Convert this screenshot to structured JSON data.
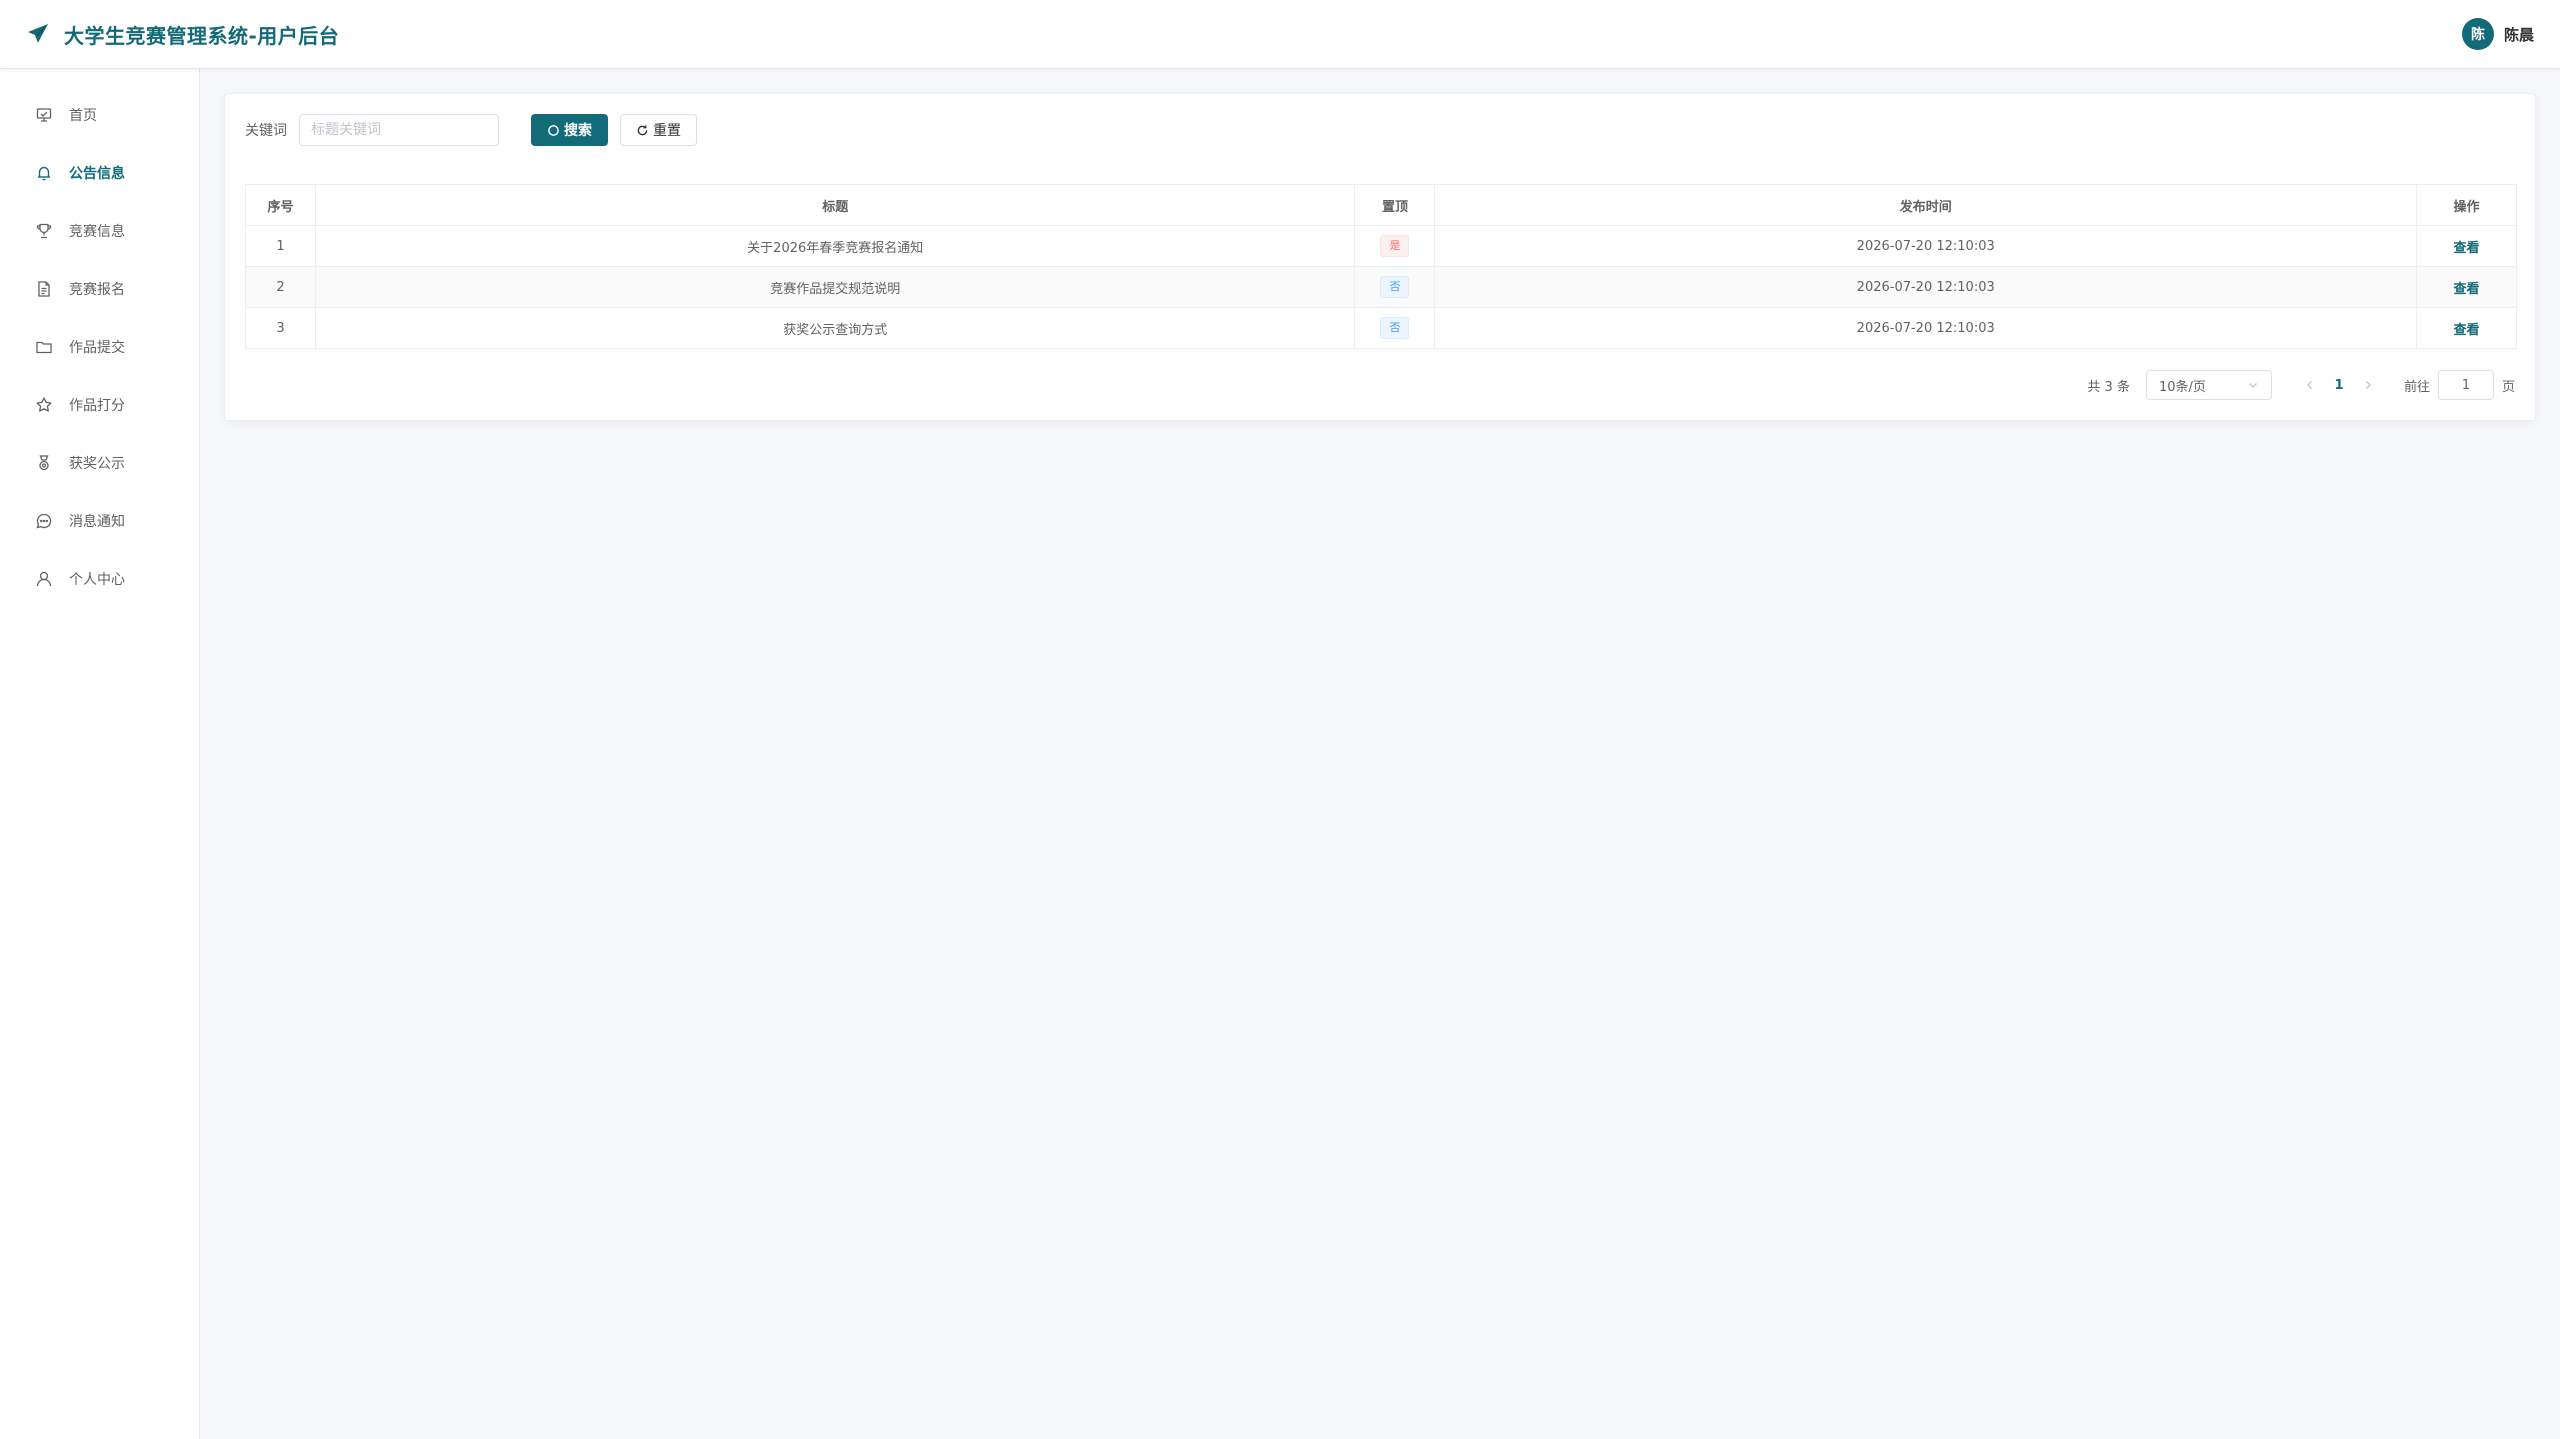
{
  "app": {
    "title": "大学生竞赛管理系统-用户后台"
  },
  "user": {
    "avatar_initial": "陈",
    "name": "陈晨"
  },
  "sidebar": {
    "items": [
      {
        "label": "首页",
        "icon": "home-icon",
        "active": false
      },
      {
        "label": "公告信息",
        "icon": "bell-icon",
        "active": true
      },
      {
        "label": "竞赛信息",
        "icon": "trophy-icon",
        "active": false
      },
      {
        "label": "竞赛报名",
        "icon": "document-icon",
        "active": false
      },
      {
        "label": "作品提交",
        "icon": "folder-icon",
        "active": false
      },
      {
        "label": "作品打分",
        "icon": "star-icon",
        "active": false
      },
      {
        "label": "获奖公示",
        "icon": "medal-icon",
        "active": false
      },
      {
        "label": "消息通知",
        "icon": "chat-icon",
        "active": false
      },
      {
        "label": "个人中心",
        "icon": "user-icon",
        "active": false
      }
    ]
  },
  "search": {
    "label": "关键词",
    "placeholder": "标题关键词",
    "value": "",
    "search_button": "搜索",
    "reset_button": "重置"
  },
  "table": {
    "headers": [
      "序号",
      "标题",
      "置顶",
      "发布时间",
      "操作"
    ],
    "rows": [
      {
        "index": "1",
        "title": "关于2026年春季竞赛报名通知",
        "pinned": "是",
        "pinned_flag": true,
        "time": "2026-07-20 12:10:03",
        "action": "查看"
      },
      {
        "index": "2",
        "title": "竞赛作品提交规范说明",
        "pinned": "否",
        "pinned_flag": false,
        "time": "2026-07-20 12:10:03",
        "action": "查看"
      },
      {
        "index": "3",
        "title": "获奖公示查询方式",
        "pinned": "否",
        "pinned_flag": false,
        "time": "2026-07-20 12:10:03",
        "action": "查看"
      }
    ]
  },
  "pagination": {
    "total_text": "共 3 条",
    "page_size": "10条/页",
    "current_page": "1",
    "goto_label": "前往",
    "goto_value": "1",
    "page_unit": "页"
  },
  "colors": {
    "primary": "#136a78",
    "danger": "#f56c6c",
    "info": "#409eff"
  }
}
